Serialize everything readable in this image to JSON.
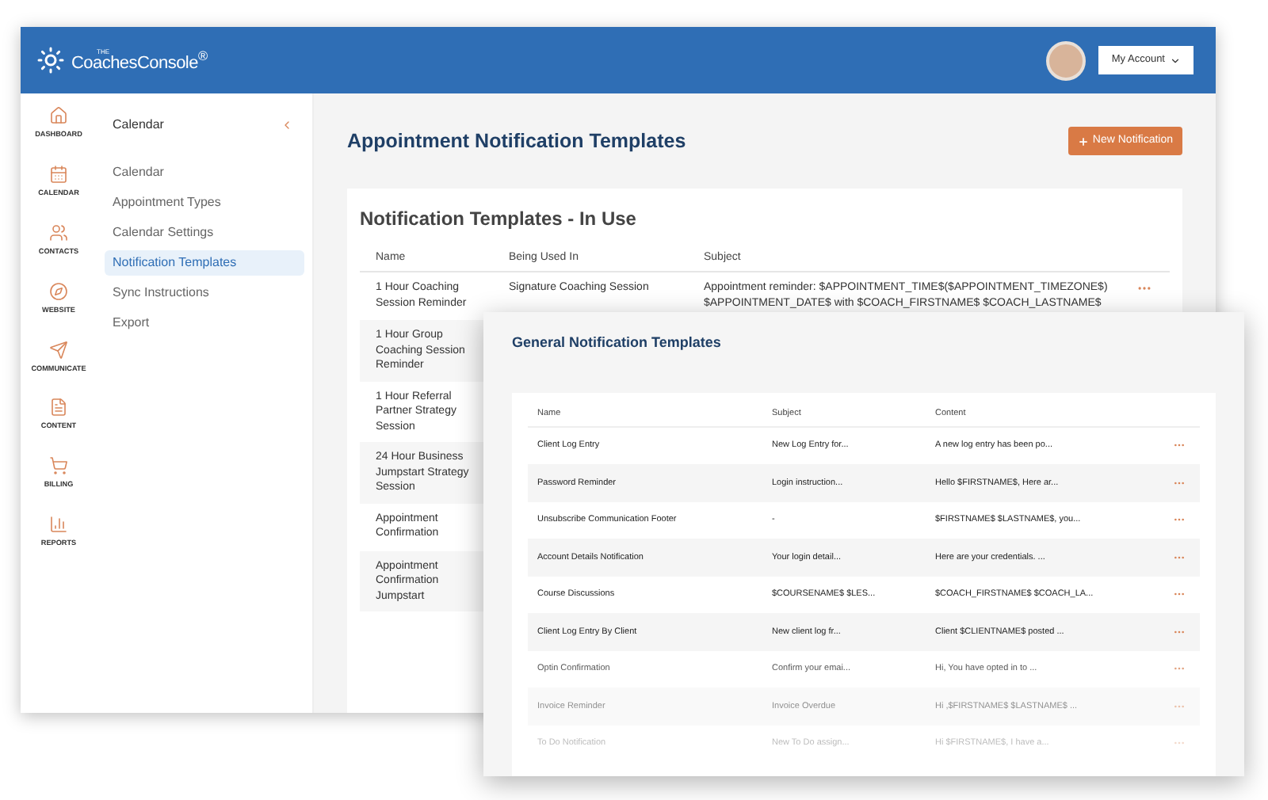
{
  "header": {
    "logo_prefix": "THE",
    "logo": "CoachesConsole",
    "logo_mark": "®",
    "account_button": "My Account"
  },
  "rail": [
    {
      "label": "DASHBOARD"
    },
    {
      "label": "CALENDAR"
    },
    {
      "label": "CONTACTS"
    },
    {
      "label": "WEBSITE"
    },
    {
      "label": "COMMUNICATE"
    },
    {
      "label": "CONTENT"
    },
    {
      "label": "BILLING"
    },
    {
      "label": "REPORTS"
    }
  ],
  "nav": {
    "title": "Calendar",
    "items": [
      {
        "label": "Calendar",
        "selected": false
      },
      {
        "label": "Appointment Types",
        "selected": false
      },
      {
        "label": "Calendar Settings",
        "selected": false
      },
      {
        "label": "Notification Templates",
        "selected": true
      },
      {
        "label": "Sync Instructions",
        "selected": false
      },
      {
        "label": "Export",
        "selected": false
      }
    ]
  },
  "page": {
    "title": "Appointment Notification Templates",
    "new_button": "New Notification"
  },
  "in_use": {
    "title": "Notification Templates - In Use",
    "columns": [
      "Name",
      "Being Used In",
      "Subject"
    ],
    "rows": [
      {
        "name": "1 Hour Coaching Session Reminder",
        "being_used_in": "Signature Coaching Session",
        "subject": "Appointment reminder: $APPOINTMENT_TIME$($APPOINTMENT_TIMEZONE$) $APPOINTMENT_DATE$ with $COACH_FIRSTNAME$ $COACH_LASTNAME$"
      },
      {
        "name": "1 Hour Group Coaching Session Reminder"
      },
      {
        "name": "1 Hour Referral Partner Strategy Session"
      },
      {
        "name": "24 Hour Business Jumpstart Strategy Session"
      },
      {
        "name": "Appointment Confirmation"
      },
      {
        "name": "Appointment Confirmation Jumpstart"
      }
    ]
  },
  "general": {
    "title": "General Notification Templates",
    "columns": [
      "Name",
      "Subject",
      "Content"
    ],
    "rows": [
      {
        "name": "Client Log Entry",
        "subject": "New Log Entry for...",
        "content": "A new log entry has been po..."
      },
      {
        "name": "Password Reminder",
        "subject": "Login instruction...",
        "content": "Hello $FIRSTNAME$, Here ar..."
      },
      {
        "name": "Unsubscribe Communication Footer",
        "subject": "-",
        "content": "$FIRSTNAME$ $LASTNAME$, you..."
      },
      {
        "name": "Account Details Notification",
        "subject": "Your login detail...",
        "content": "Here are your credentials. ..."
      },
      {
        "name": "Course Discussions",
        "subject": "$COURSENAME$ $LES...",
        "content": "$COACH_FIRSTNAME$ $COACH_LA..."
      },
      {
        "name": "Client Log Entry By Client",
        "subject": "New client log fr...",
        "content": "Client $CLIENTNAME$ posted ..."
      },
      {
        "name": "Optin Confirmation",
        "subject": "Confirm your emai...",
        "content": "Hi, You have opted in to ..."
      },
      {
        "name": "Invoice Reminder",
        "subject": "Invoice Overdue",
        "content": "Hi ,$FIRSTNAME$ $LASTNAME$ ..."
      },
      {
        "name": "To Do Notification",
        "subject": "New To Do assign...",
        "content": "Hi $FIRSTNAME$, I have a..."
      }
    ]
  }
}
